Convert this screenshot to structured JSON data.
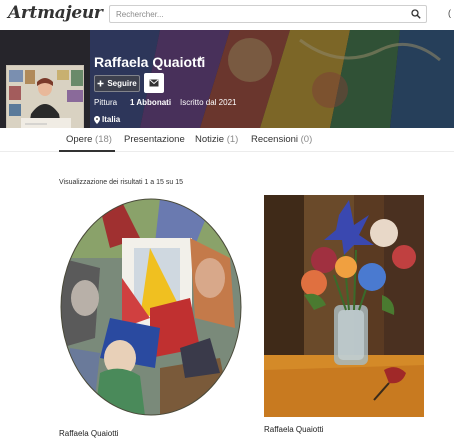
{
  "brand": {
    "logo_text": "Artmajeur"
  },
  "search": {
    "placeholder": "Rechercher...",
    "icon": "search-icon"
  },
  "artist": {
    "name": "Raffaela Quaiotti",
    "badge": "*",
    "follow_label": "Seguire",
    "follow_icon": "plus-icon",
    "message_icon": "envelope-icon",
    "category": "Pittura",
    "followers": "1 Abbonati",
    "joined": "Iscritto dal 2021",
    "location": "Italia",
    "location_icon": "map-pin-icon"
  },
  "tabs": [
    {
      "label": "Opere",
      "count": "(18)",
      "active": true
    },
    {
      "label": "Presentazione",
      "count": ""
    },
    {
      "label": "Notizie",
      "count": "(1)"
    },
    {
      "label": "Recensioni",
      "count": "(0)"
    }
  ],
  "results_text": "Visualizzazione dei risultati 1 a 15 su 15",
  "artworks": [
    {
      "artist": "Raffaela Quaiotti"
    },
    {
      "artist": "Raffaela Quaiotti"
    }
  ],
  "colors": {
    "accent_text": "#333333",
    "muted": "#8a8a8a",
    "banner_overlay": "#1f1f1f"
  }
}
